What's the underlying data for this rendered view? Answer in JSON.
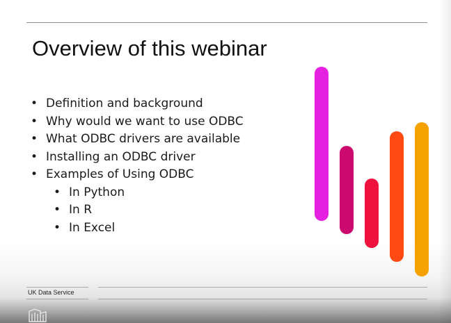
{
  "slide": {
    "title": "Overview of this webinar",
    "bullets": [
      {
        "text": "Definition and background",
        "level": 1
      },
      {
        "text": "Why would we want to use ODBC",
        "level": 1
      },
      {
        "text": "What ODBC drivers are available",
        "level": 1
      },
      {
        "text": "Installing an ODBC driver",
        "level": 1
      },
      {
        "text": "Examples of Using ODBC",
        "level": 1
      },
      {
        "text": "In Python",
        "level": 2
      },
      {
        "text": "In R",
        "level": 2
      },
      {
        "text": "In Excel",
        "level": 2
      }
    ],
    "bullet_glyph": "•",
    "footer_label": "UK Data Service",
    "logo_icon": "uk-data-service-logo-icon"
  },
  "colors": {
    "bar_magenta": "#e620e0",
    "bar_crimson": "#cc0a6e",
    "bar_red": "#f0123e",
    "bar_orange": "#ff4a14",
    "bar_amber": "#f5a200"
  }
}
